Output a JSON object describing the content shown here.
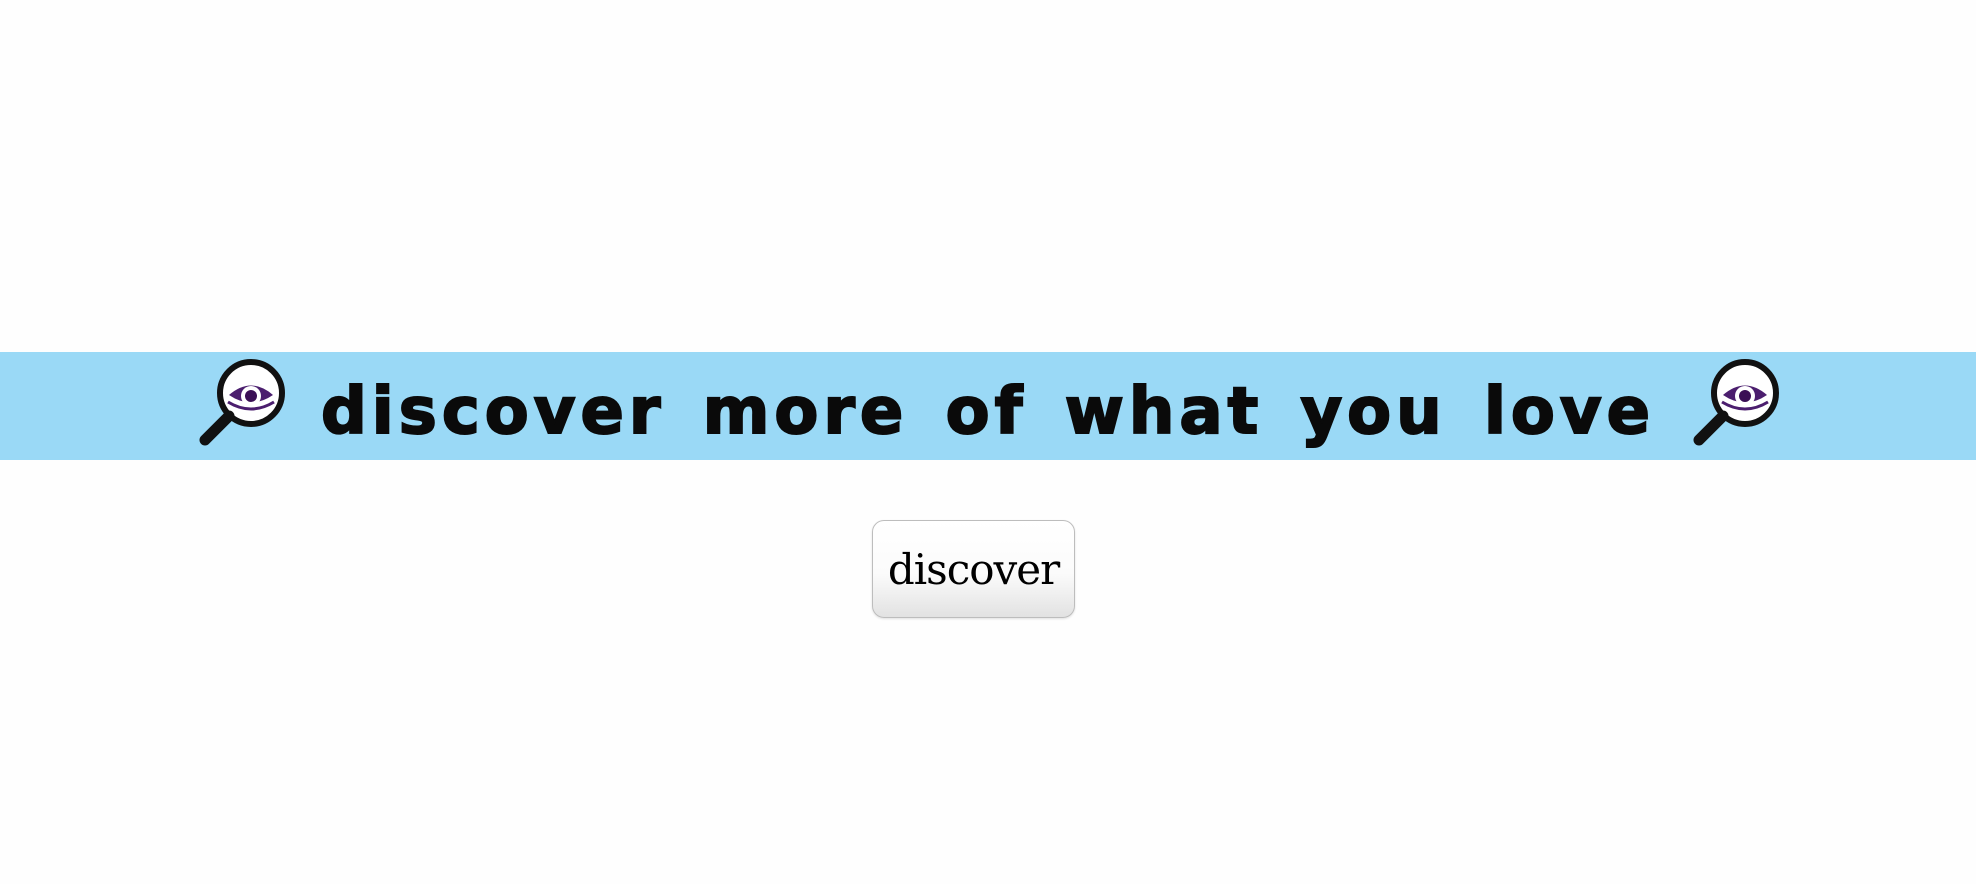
{
  "banner": {
    "text": "discover more of what you love",
    "background_color": "#9ad9f6",
    "left_icon": "magnifying-glass-eye-icon",
    "right_icon": "magnifying-glass-eye-icon"
  },
  "button": {
    "label": "discover"
  }
}
